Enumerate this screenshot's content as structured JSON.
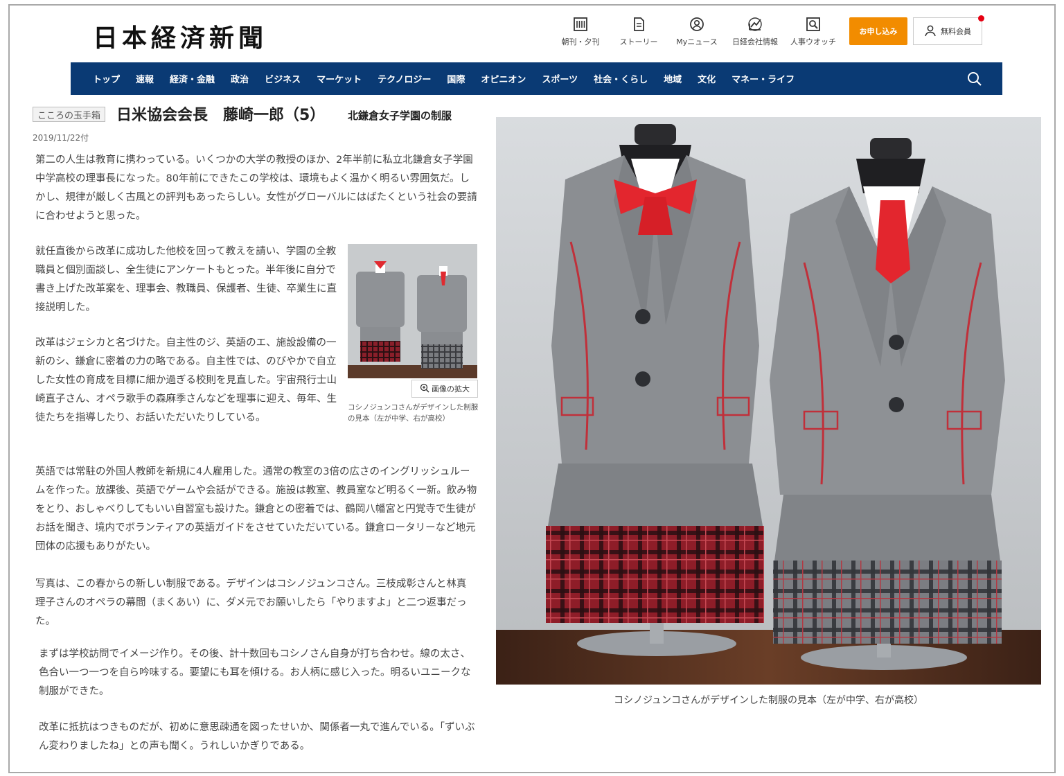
{
  "header": {
    "logo": "日本経済新聞",
    "util_nav": [
      {
        "label": "朝刊・夕刊",
        "icon": "newspaper-icon"
      },
      {
        "label": "ストーリー",
        "icon": "document-icon"
      },
      {
        "label": "Myニュース",
        "icon": "user-circle-icon"
      },
      {
        "label": "日経会社情報",
        "icon": "chart-icon"
      },
      {
        "label": "人事ウオッチ",
        "icon": "search-person-icon"
      }
    ],
    "apply_label": "お申し込み",
    "member_label": "無料会員"
  },
  "nav": {
    "items": [
      "トップ",
      "速報",
      "経済・金融",
      "政治",
      "ビジネス",
      "マーケット",
      "テクノロジー",
      "国際",
      "オピニオン",
      "スポーツ",
      "社会・くらし",
      "地域",
      "文化",
      "マネー・ライフ"
    ]
  },
  "article": {
    "kicker": "こころの玉手箱",
    "headline": "日米協会会長　藤崎一郎（5）",
    "subhead": "北鎌倉女子学園の制服",
    "date": "2019/11/22付",
    "paragraphs": [
      "第二の人生は教育に携わっている。いくつかの大学の教授のほか、2年半前に私立北鎌倉女子学園中学高校の理事長になった。80年前にできたこの学校は、環境もよく温かく明るい雰囲気だ。しかし、規律が厳しく古風との評判もあったらしい。女性がグローバルにはばたくという社会の要請に合わせようと思った。",
      "就任直後から改革に成功した他校を回って教えを請い、学園の全教職員と個別面談し、全生徒にアンケートもとった。半年後に自分で書き上げた改革案を、理事会、教職員、保護者、生徒、卒業生に直接説明した。",
      "改革はジェシカと名づけた。自主性のジ、英語のエ、施設設備の一新のシ、鎌倉に密着の力の略である。自主性では、のびやかで自立した女性の育成を目標に細か過ぎる校則を見直した。宇宙飛行士山崎直子さん、オペラ歌手の森麻季さんなどを理事に迎え、毎年、生徒たちを指導したり、お話いただいたりしている。",
      "英語では常駐の外国人教師を新規に4人雇用した。通常の教室の3倍の広さのイングリッシュルームを作った。放課後、英語でゲームや会話ができる。施設は教室、教員室など明るく一新。飲み物をとり、おしゃべりしてもいい自習室も設けた。鎌倉との密着では、鶴岡八幡宮と円覚寺で生徒がお話を聞き、境内でボランティアの英語ガイドをさせていただいている。鎌倉ロータリーなど地元団体の応援もありがたい。",
      "写真は、この春からの新しい制服である。デザインはコシノジュンコさん。三枝成彰さんと林真理子さんのオペラの幕間（まくあい）に、ダメ元でお願いしたら「やりますよ」と二つ返事だった。",
      "まずは学校訪問でイメージ作り。その後、計十数回もコシノさん自身が打ち合わせ。線の太さ、色合い一つ一つを自ら吟味する。要望にも耳を傾ける。お人柄に感じ入った。明るいユニークな制服ができた。",
      "改革に抵抗はつきものだが、初めに意思疎通を図ったせいか、関係者一丸で進んでいる。「ずいぶん変わりましたね」との声も聞く。うれしいかぎりである。"
    ],
    "thumb_zoom_label": "画像の拡大",
    "thumb_caption": "コシノジュンコさんがデザインした制服の見本（左が中学、右が高校）",
    "photo_caption": "コシノジュンコさんがデザインした制服の見本（左が中学、右が高校）"
  },
  "colors": {
    "nav_bg": "#0a3a74",
    "apply_bg": "#f28c00",
    "notification_dot": "#e60012"
  }
}
